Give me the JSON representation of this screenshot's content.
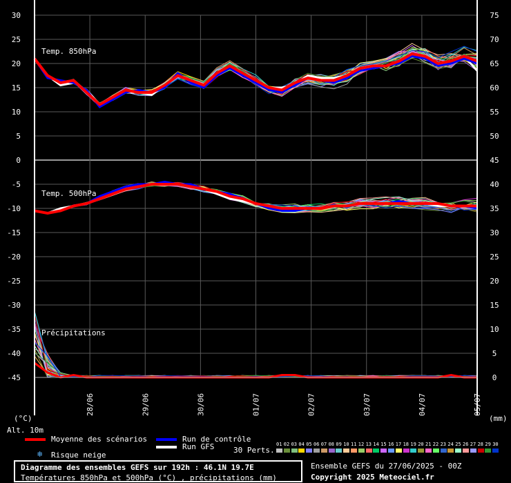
{
  "chart_data": {
    "type": "line",
    "title": "Diagramme des ensembles GEFS sur 192h : 46.1N 19.7E",
    "subtitle": "Températures 850hPa et 500hPa (°C) , précipitations (mm)",
    "run_info": "Ensemble GEFS du 27/06/2025 - 00Z",
    "copyright": "Copyright 2025 Meteociel.fr",
    "left_axis": {
      "unit": "(°C)",
      "ticks": [
        30,
        25,
        20,
        15,
        10,
        5,
        0,
        -5,
        -10,
        -15,
        -20,
        -25,
        -30,
        -35,
        -40,
        -45
      ],
      "ylim": [
        -45,
        30
      ]
    },
    "right_axis": {
      "unit": "(mm)",
      "ticks": [
        75,
        70,
        65,
        60,
        55,
        50,
        45,
        40,
        35,
        30,
        25,
        20,
        15,
        10,
        5,
        0
      ],
      "ylim": [
        0,
        75
      ]
    },
    "x_ticks": [
      "28/06",
      "29/06",
      "30/06",
      "01/07",
      "02/07",
      "03/07",
      "04/07",
      "05/07"
    ],
    "x_range_hours": [
      0,
      192
    ],
    "grid": true,
    "panel_labels": {
      "t850": "Temp. 850hPa",
      "t500": "Temp. 500hPa",
      "precip": "Précipitations"
    },
    "alt_label": "Alt. 10m",
    "series": [
      {
        "name": "Moyenne des scénarios",
        "color": "#ff0000",
        "width": 4,
        "t850": [
          21,
          17.5,
          16,
          16.5,
          14,
          11.5,
          13,
          14.5,
          14,
          14,
          15.5,
          17.5,
          16.5,
          15.5,
          18,
          19.5,
          18,
          16.5,
          15,
          14.5,
          16,
          17,
          16.5,
          16.5,
          17.5,
          19,
          19.5,
          19.5,
          20.5,
          22,
          21.5,
          20,
          20.5,
          21.5,
          20.5
        ],
        "t500": [
          -10.5,
          -11,
          -10.5,
          -9.5,
          -9,
          -8,
          -7,
          -6,
          -5.5,
          -5,
          -5,
          -5,
          -5.5,
          -6,
          -6.5,
          -7.5,
          -8,
          -9,
          -9.5,
          -10,
          -10,
          -10,
          -10,
          -9.5,
          -9.5,
          -9,
          -9,
          -9,
          -9,
          -9,
          -9,
          -9,
          -9.5,
          -9.5,
          -9.5
        ]
      },
      {
        "name": "Run de contrôle",
        "color": "#0000ff",
        "width": 3,
        "t850": [
          21,
          17,
          16.5,
          16,
          14.5,
          11,
          12.5,
          14,
          14.5,
          14,
          15,
          18,
          16,
          15,
          17.5,
          19,
          17.5,
          16,
          14.5,
          14,
          15.5,
          17,
          16.5,
          16,
          17,
          18.5,
          19,
          19.5,
          20,
          21.5,
          21,
          19.5,
          20,
          21,
          20
        ],
        "t500": [
          -10.5,
          -11,
          -10.5,
          -9.5,
          -9,
          -7.5,
          -6.5,
          -5.5,
          -5,
          -5,
          -4.5,
          -5,
          -5,
          -6,
          -6.5,
          -7,
          -8,
          -9,
          -10,
          -10.5,
          -10.5,
          -10,
          -10,
          -9.5,
          -9.5,
          -9,
          -9,
          -9,
          -8.5,
          -9,
          -9,
          -9,
          -9.5,
          -9.5,
          -10
        ]
      },
      {
        "name": "Run GFS",
        "color": "#ffffff",
        "width": 3,
        "t850": [
          21,
          17.5,
          15.5,
          16,
          14.5,
          11.5,
          12.5,
          14,
          14,
          13.5,
          15.5,
          17.5,
          16.5,
          15.5,
          17.5,
          19,
          18,
          16,
          15,
          15,
          15.5,
          17.5,
          17,
          17,
          17.5,
          19,
          19,
          19.5,
          20,
          21.5,
          21,
          20,
          20.5,
          21.5,
          18.5
        ],
        "t500": [
          -10.5,
          -11,
          -10,
          -9.5,
          -9,
          -8,
          -6.5,
          -5.5,
          -5,
          -5,
          -5,
          -5,
          -5.5,
          -6,
          -7,
          -8,
          -8.5,
          -9,
          -9.5,
          -10,
          -10,
          -10,
          -10,
          -9.5,
          -9.5,
          -9,
          -9,
          -9,
          -9,
          -9,
          -9,
          -9.5,
          -9.5,
          -9.5,
          -9.5
        ]
      }
    ],
    "mean_precip_mm": [
      3,
      1,
      0,
      0.5,
      0,
      0,
      0,
      0,
      0,
      0,
      0,
      0,
      0,
      0,
      0,
      0,
      0,
      0,
      0,
      0.5,
      0.5,
      0,
      0,
      0,
      0,
      0,
      0,
      0,
      0,
      0,
      0,
      0,
      0.5,
      0,
      0
    ],
    "legend": {
      "mean": "Moyenne des scénarios",
      "control": "Run de contrôle",
      "gfs": "Run GFS",
      "snow": "Risque neige",
      "perts": "30 Perts."
    },
    "perturbations": {
      "labels": [
        "01",
        "02",
        "03",
        "04",
        "05",
        "06",
        "07",
        "08",
        "09",
        "10",
        "11",
        "12",
        "13",
        "14",
        "15",
        "16",
        "17",
        "18",
        "19",
        "20",
        "21",
        "22",
        "23",
        "24",
        "25",
        "26",
        "27",
        "28",
        "29",
        "30"
      ],
      "colors": [
        "#c0c0c0",
        "#6a8f3a",
        "#7fbf7f",
        "#ffd700",
        "#8080ff",
        "#a0a0a0",
        "#cc9966",
        "#9966cc",
        "#66cccc",
        "#ffcc99",
        "#ff9966",
        "#99cc66",
        "#ff6666",
        "#00cc66",
        "#cc66ff",
        "#6699ff",
        "#ffff66",
        "#cc33cc",
        "#33cccc",
        "#999933",
        "#ff66cc",
        "#66ff66",
        "#3366cc",
        "#cc9933",
        "#99ffcc",
        "#ff9999",
        "#9999ff",
        "#cc0000",
        "#339933",
        "#0033cc"
      ]
    }
  }
}
